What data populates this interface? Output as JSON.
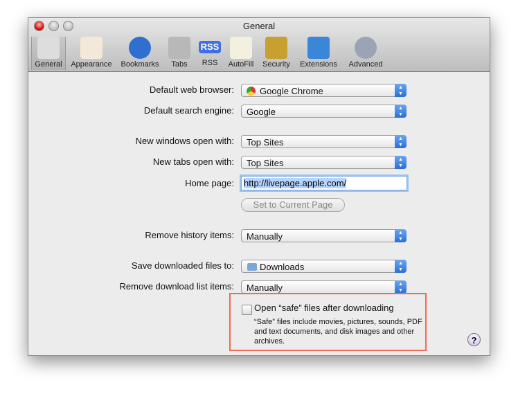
{
  "window": {
    "title": "General"
  },
  "toolbar": [
    {
      "label": "General",
      "icon": "switch-icon",
      "color": "#ddd"
    },
    {
      "label": "Appearance",
      "icon": "appearance-icon",
      "color": "#f4e8d8"
    },
    {
      "label": "Bookmarks",
      "icon": "globe-icon",
      "color": "#2f6fd0"
    },
    {
      "label": "Tabs",
      "icon": "tabs-icon",
      "color": "#b8b8b8"
    },
    {
      "label": "RSS",
      "icon": "rss-icon",
      "color": "#3f6fe0"
    },
    {
      "label": "AutoFill",
      "icon": "pencil-icon",
      "color": "#f4f0e0"
    },
    {
      "label": "Security",
      "icon": "lock-icon",
      "color": "#c8a030"
    },
    {
      "label": "Extensions",
      "icon": "puzzle-icon",
      "color": "#3a86d8"
    },
    {
      "label": "Advanced",
      "icon": "gear-icon",
      "color": "#9aa4b4"
    }
  ],
  "form": {
    "default_browser_label": "Default web browser:",
    "default_browser": "Google Chrome",
    "search_engine_label": "Default search engine:",
    "search_engine": "Google",
    "new_windows_label": "New windows open with:",
    "new_windows": "Top Sites",
    "new_tabs_label": "New tabs open with:",
    "new_tabs": "Top Sites",
    "home_page_label": "Home page:",
    "home_page": "http://livepage.apple.com/",
    "set_current": "Set to Current Page",
    "history_label": "Remove history items:",
    "history": "Manually",
    "save_to_label": "Save downloaded files to:",
    "save_to": "Downloads",
    "remove_dl_label": "Remove download list items:",
    "remove_dl": "Manually",
    "open_safe_label": "Open “safe” files after downloading",
    "open_safe_checked": false,
    "open_safe_note": "“Safe” files include movies, pictures, sounds, PDF and text documents, and disk images and other archives.",
    "help": "?"
  }
}
